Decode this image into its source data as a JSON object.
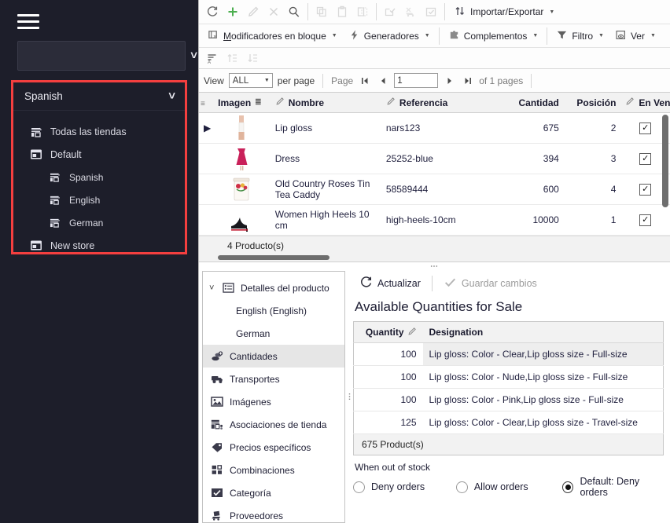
{
  "sidebar": {
    "menu_icon": "hamburger-icon",
    "store_search_value": "",
    "store_search_placeholder": "",
    "language_header": {
      "label": "Spanish",
      "chevron": "chevron-down-icon"
    },
    "tree": [
      {
        "label": "Todas las tiendas",
        "icon": "store-icon",
        "level": 1
      },
      {
        "label": "Default",
        "icon": "folder-icon",
        "level": 1
      },
      {
        "label": "Spanish",
        "icon": "store-icon",
        "level": 2
      },
      {
        "label": "English",
        "icon": "store-icon",
        "level": 2
      },
      {
        "label": "German",
        "icon": "store-icon",
        "level": 2
      },
      {
        "label": "New store",
        "icon": "folder-icon",
        "level": 1
      }
    ],
    "highlight_color": "#f43f3f",
    "background_color": "#1d1e2a"
  },
  "toolbar_row1": {
    "icons": [
      {
        "name": "refresh-icon",
        "enabled": true
      },
      {
        "name": "add-icon",
        "enabled": true,
        "color": "#4caf50"
      },
      {
        "name": "edit-pencil-icon",
        "enabled": false
      },
      {
        "name": "delete-x-icon",
        "enabled": false
      },
      {
        "name": "search-icon",
        "enabled": true
      },
      {
        "name": "copy-icon",
        "enabled": false
      },
      {
        "name": "paste-icon",
        "enabled": false
      },
      {
        "name": "duplicate-icon",
        "enabled": false
      },
      {
        "name": "select-all-icon",
        "enabled": false
      },
      {
        "name": "deselect-icon",
        "enabled": false
      },
      {
        "name": "check-list-icon",
        "enabled": false
      }
    ],
    "import_export_label": "Importar/Exportar"
  },
  "toolbar_row2": [
    {
      "label": "Modificadores en bloque",
      "icon": "bulk-modifier-icon",
      "accesskey": "M"
    },
    {
      "label": "Generadores",
      "icon": "lightning-icon"
    },
    {
      "label": "Complementos",
      "icon": "puzzle-icon"
    },
    {
      "label": "Filtro",
      "icon": "funnel-icon"
    },
    {
      "label": "Ver",
      "icon": "eye-view-icon"
    }
  ],
  "toolbar_row3": [
    {
      "name": "sort-alpha-icon"
    },
    {
      "name": "sort-asc-icon"
    },
    {
      "name": "sort-desc-icon"
    }
  ],
  "viewbar": {
    "view_label": "View",
    "per_page_value": "ALL",
    "per_page_label": "per page",
    "page_label": "Page",
    "first_icon": "first-page-icon",
    "prev_icon": "prev-page-icon",
    "page_value": "1",
    "next_icon": "next-page-icon",
    "last_icon": "last-page-icon",
    "of_pages": "of 1 pages"
  },
  "product_grid": {
    "columns": [
      {
        "label": "Imagen",
        "editable": false,
        "align": "left"
      },
      {
        "label": "Nombre",
        "editable": true,
        "align": "left"
      },
      {
        "label": "Referencia",
        "editable": true,
        "align": "left"
      },
      {
        "label": "Cantidad",
        "editable": false,
        "align": "right"
      },
      {
        "label": "Posición",
        "editable": false,
        "align": "right"
      },
      {
        "label": "En Venta",
        "editable": true,
        "align": "center"
      }
    ],
    "rows": [
      {
        "nombre": "Lip gloss",
        "referencia": "nars123",
        "cantidad": "675",
        "posicion": "2",
        "en_venta": true,
        "thumb": "lipgloss"
      },
      {
        "nombre": "Dress",
        "referencia": "25252-blue",
        "cantidad": "394",
        "posicion": "3",
        "en_venta": true,
        "thumb": "dress"
      },
      {
        "nombre": "Old Country Roses Tin Tea Caddy",
        "referencia": "58589444",
        "cantidad": "600",
        "posicion": "4",
        "en_venta": true,
        "thumb": "caddy"
      },
      {
        "nombre": "Women High Heels 10 cm",
        "referencia": "high-heels-10cm",
        "cantidad": "10000",
        "posicion": "1",
        "en_venta": true,
        "thumb": "heels"
      }
    ],
    "footer_count": "4 Producto(s)"
  },
  "detail_tree": {
    "root": {
      "label": "Detalles del producto",
      "icon": "details-list-icon",
      "expanded": true
    },
    "items": [
      {
        "label": "English (English)",
        "icon": "",
        "child": true,
        "selected": false
      },
      {
        "label": "German",
        "icon": "",
        "child": true,
        "selected": false
      },
      {
        "label": "Cantidades",
        "icon": "quantities-icon",
        "child": false,
        "selected": true
      },
      {
        "label": "Transportes",
        "icon": "truck-icon",
        "child": false,
        "selected": false
      },
      {
        "label": "Imágenes",
        "icon": "image-icon",
        "child": false,
        "selected": false
      },
      {
        "label": "Asociaciones de tienda",
        "icon": "store-association-icon",
        "child": false,
        "selected": false
      },
      {
        "label": "Precios específicos",
        "icon": "price-tag-icon",
        "child": false,
        "selected": false
      },
      {
        "label": "Combinaciones",
        "icon": "combinations-icon",
        "child": false,
        "selected": false
      },
      {
        "label": "Categoría",
        "icon": "category-check-icon",
        "child": false,
        "selected": false
      },
      {
        "label": "Proveedores",
        "icon": "supplier-icon",
        "child": false,
        "selected": false
      }
    ]
  },
  "detail_pane": {
    "refresh_label": "Actualizar",
    "refresh_icon": "refresh-icon",
    "save_label": "Guardar cambios",
    "save_icon": "check-icon",
    "save_enabled": false,
    "title": "Available Quantities for Sale",
    "quantity_grid": {
      "columns": [
        {
          "label": "Quantity",
          "editable": true,
          "align": "right"
        },
        {
          "label": "Designation",
          "editable": false,
          "align": "left"
        }
      ],
      "rows": [
        {
          "quantity": "100",
          "designation": "Lip gloss: Color - Clear,Lip gloss size - Full-size",
          "highlighted": true
        },
        {
          "quantity": "100",
          "designation": "Lip gloss: Color - Nude,Lip gloss size - Full-size",
          "highlighted": false
        },
        {
          "quantity": "100",
          "designation": "Lip gloss: Color - Pink,Lip gloss size - Full-size",
          "highlighted": false
        },
        {
          "quantity": "125",
          "designation": "Lip gloss: Color - Clear,Lip gloss size - Travel-size",
          "highlighted": false
        }
      ],
      "footer": "675 Product(s)"
    },
    "out_of_stock": {
      "label": "When out of stock",
      "options": [
        {
          "label": "Deny orders",
          "selected": false
        },
        {
          "label": "Allow orders",
          "selected": false
        },
        {
          "label": "Default: Deny orders",
          "selected": true
        }
      ]
    }
  }
}
